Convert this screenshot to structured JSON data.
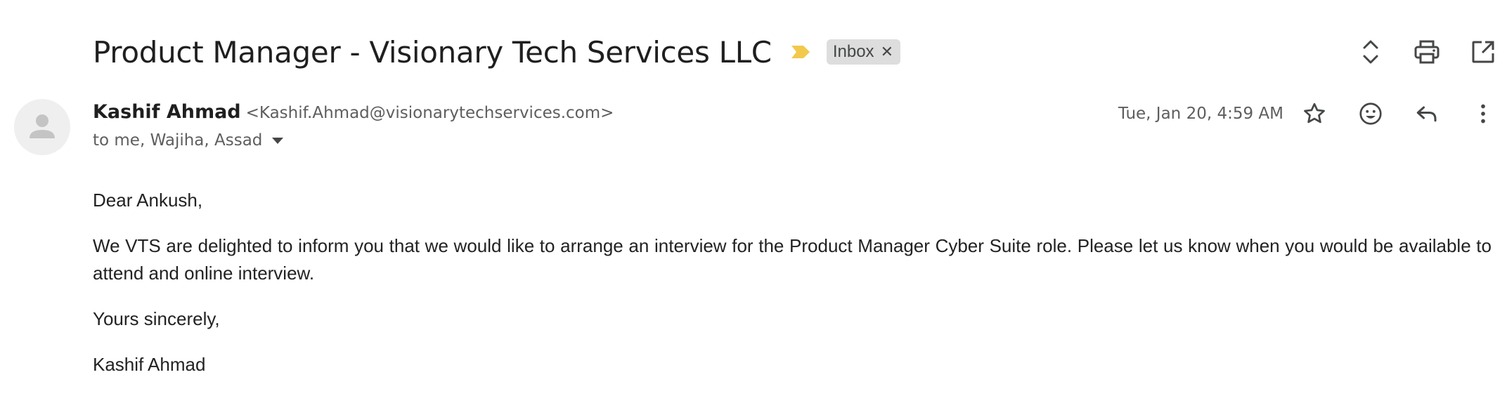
{
  "subject": "Product Manager - Visionary Tech Services LLC",
  "label": {
    "name": "Inbox",
    "remove_icon": "close-icon"
  },
  "colors": {
    "importance_marker": "#f2c94c",
    "chip_bg": "#dddddd",
    "muted_text": "#5e5e5e"
  },
  "sender": {
    "name": "Kashif Ahmad",
    "email": "<Kashif.Ahmad@visionarytechservices.com>",
    "recipients": "to me, Wajiha, Assad",
    "avatar_icon": "person-icon"
  },
  "date": "Tue, Jan 20, 4:59 AM",
  "toolbar_icons": [
    "expand-collapse-icon",
    "print-icon",
    "open-in-new-window-icon"
  ],
  "message_icons": [
    "star-icon",
    "emoji-icon",
    "reply-icon",
    "more-vert-icon"
  ],
  "body": {
    "greeting": "Dear Ankush,",
    "paragraph": "We VTS are delighted to inform you that we would like to arrange an interview for the Product Manager Cyber Suite role. Please let us know when you would be available to attend and online interview.",
    "closing": "Yours sincerely,",
    "signature": "Kashif Ahmad"
  }
}
